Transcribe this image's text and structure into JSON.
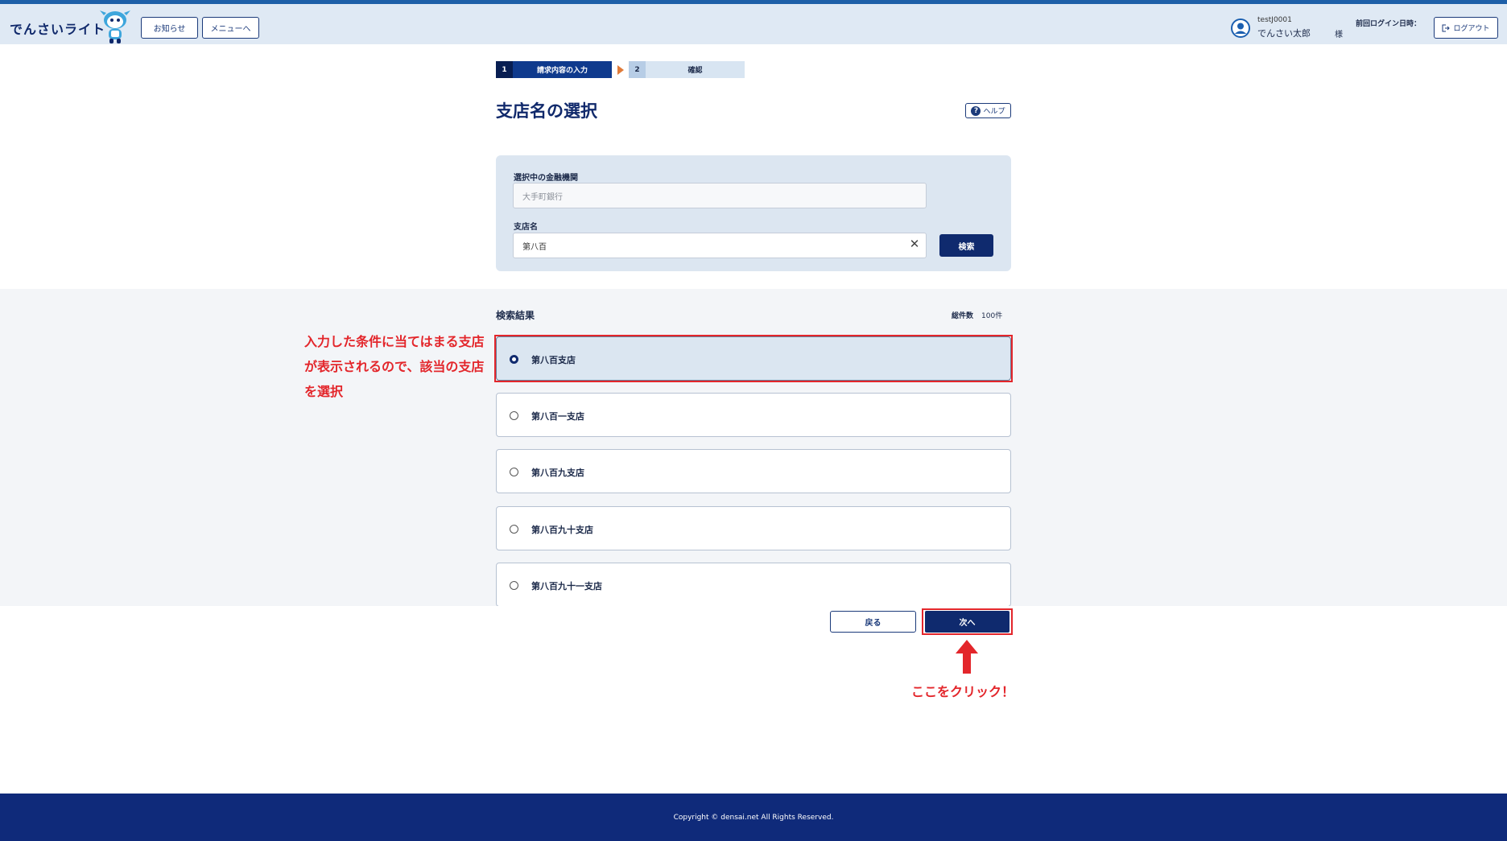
{
  "header": {
    "logo_text": "でんさいライト",
    "news_button": "お知らせ",
    "menu_button": "メニューへ",
    "user_id": "testJ0001",
    "user_name": "でんさい太郎",
    "honorific": "様",
    "last_login_label": "前回ログイン日時：",
    "logout_button": "ログアウト"
  },
  "stepper": {
    "steps": [
      {
        "number": "1",
        "label": "請求内容の入力"
      },
      {
        "number": "2",
        "label": "確認"
      }
    ]
  },
  "page": {
    "title": "支店名の選択",
    "help_button": "ヘルプ"
  },
  "form": {
    "bank_label": "選択中の金融機関",
    "bank_value": "大手町銀行",
    "branch_label": "支店名",
    "branch_value": "第八百",
    "search_button": "検索"
  },
  "results": {
    "title": "検索結果",
    "total_label": "総件数",
    "total_value": "100件",
    "items": [
      {
        "label": "第八百支店",
        "selected": true
      },
      {
        "label": "第八百一支店",
        "selected": false
      },
      {
        "label": "第八百九支店",
        "selected": false
      },
      {
        "label": "第八百九十支店",
        "selected": false
      },
      {
        "label": "第八百九十一支店",
        "selected": false
      }
    ]
  },
  "annotations": {
    "select_note": "入力した条件に当てはまる支店が表示されるので、該当の支店を選択",
    "click_note": "ここをクリック！",
    "highlight_color": "#e3262b"
  },
  "actions": {
    "back_button": "戻る",
    "next_button": "次へ"
  },
  "footer": {
    "copyright": "Copyright © densai.net All Rights Reserved."
  },
  "colors": {
    "primary": "#0f2a6e",
    "header_bg": "#dfe9f4",
    "step_arrow": "#e07b39"
  }
}
